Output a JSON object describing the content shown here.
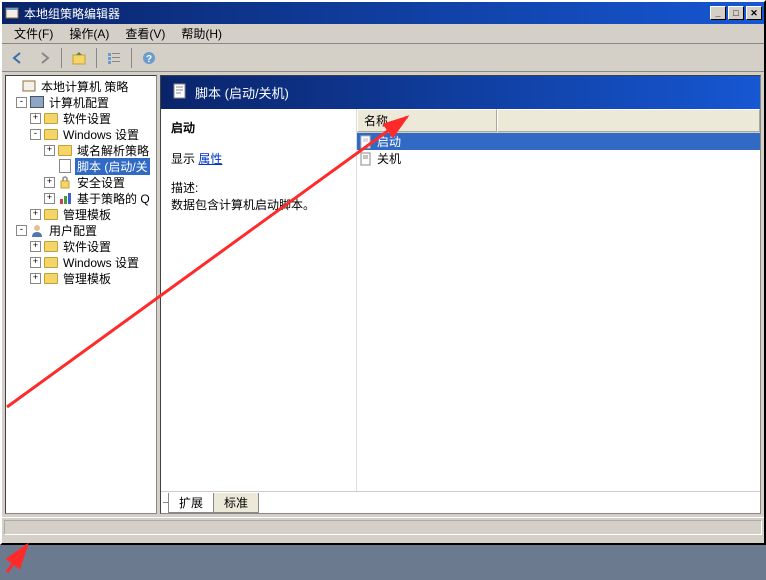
{
  "titlebar": {
    "title": "本地组策略编辑器"
  },
  "menu": {
    "file": "文件(F)",
    "action": "操作(A)",
    "view": "查看(V)",
    "help": "帮助(H)"
  },
  "tree": {
    "root": "本地计算机 策略",
    "computer_cfg": "计算机配置",
    "software": "软件设置",
    "windows": "Windows 设置",
    "dns": "域名解析策略",
    "scripts": "脚本 (启动/关",
    "security": "安全设置",
    "qos": "基于策略的 Q",
    "admin_templates": "管理模板",
    "user_cfg": "用户配置",
    "software2": "软件设置",
    "windows2": "Windows 设置",
    "admin_templates2": "管理模板"
  },
  "detail": {
    "header": "脚本 (启动/关机)",
    "selected": "启动",
    "display_label": "显示",
    "properties_link": "属性",
    "desc_label": "描述:",
    "desc_text": "数据包含计算机启动脚本。"
  },
  "list": {
    "col_name": "名称",
    "items": [
      {
        "label": "启动"
      },
      {
        "label": "关机"
      }
    ]
  },
  "tabs": {
    "ext": "扩展",
    "std": "标准"
  }
}
